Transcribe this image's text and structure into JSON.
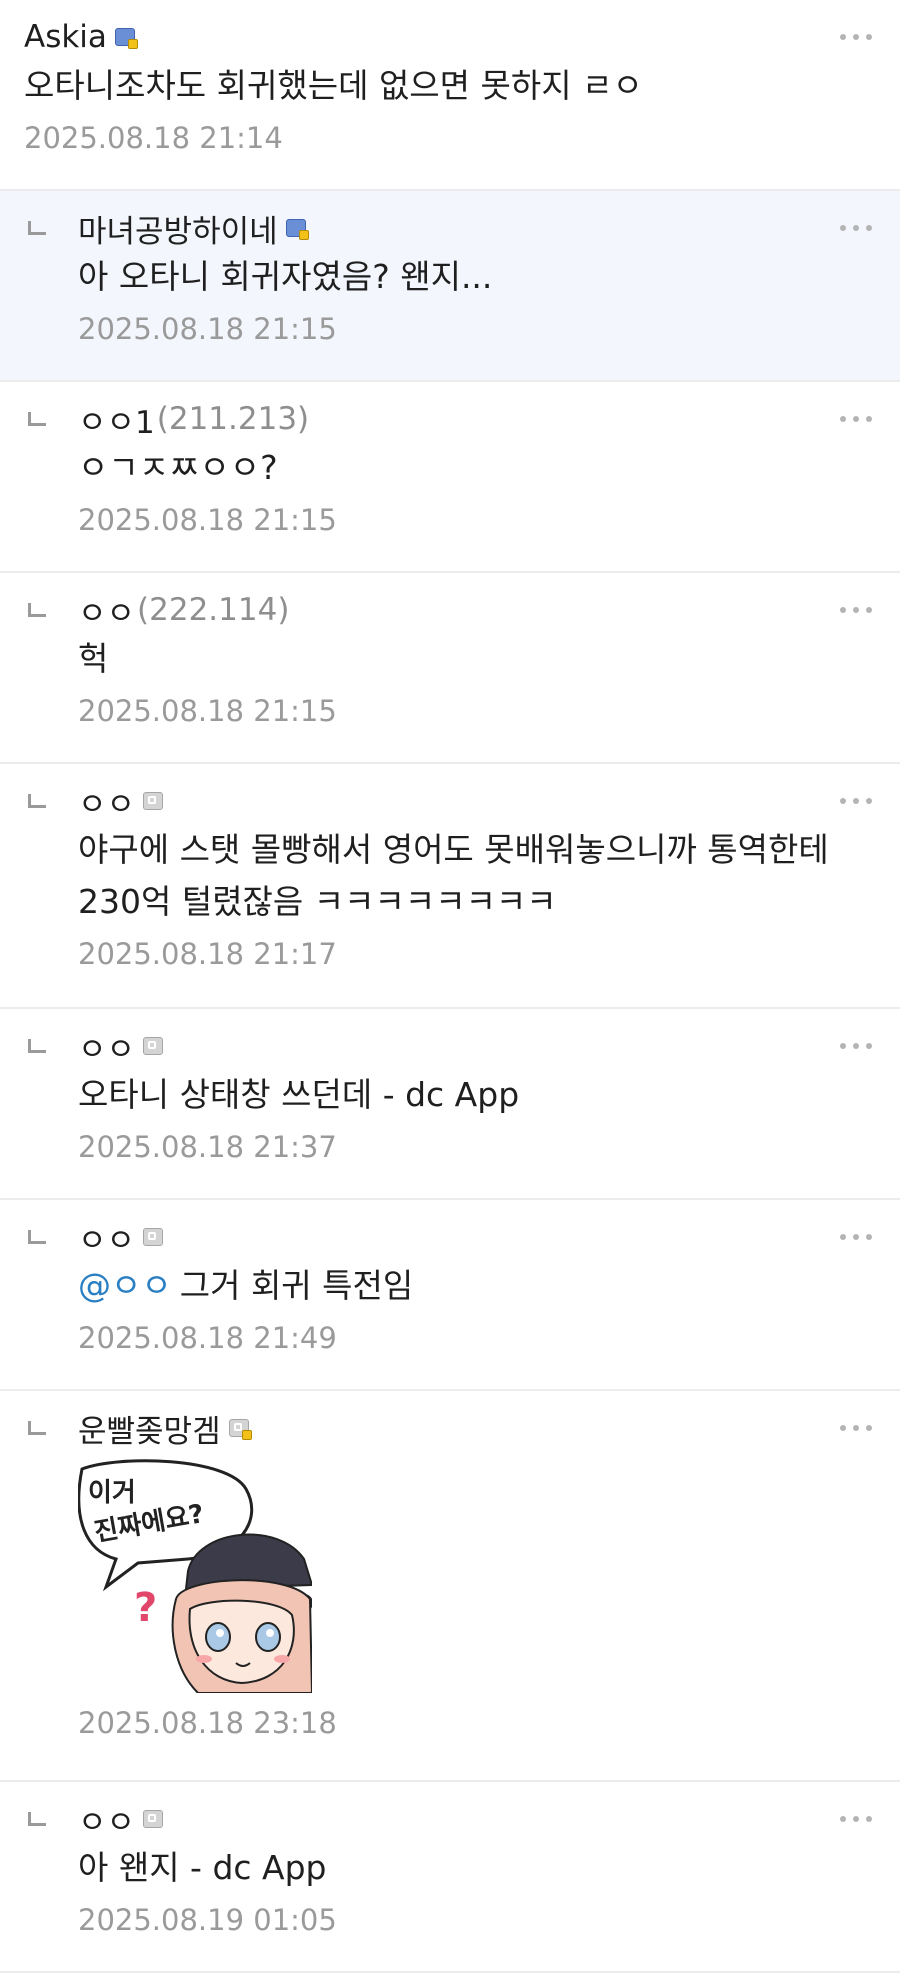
{
  "comments": [
    {
      "nick": "Askia",
      "ip": "",
      "text": "오타니조차도 회귀했는데 없으면 못하지 ㄹㅇ",
      "time": "2025.08.18 21:14"
    },
    {
      "nick": "마녀공방하이네",
      "ip": "",
      "text": "아 오타니 회귀자였음? 왠지...",
      "time": "2025.08.18 21:15"
    },
    {
      "nick": "ㅇㅇ1",
      "ip": "(211.213)",
      "text": "ㅇㄱㅈㅉㅇㅇ?",
      "time": "2025.08.18 21:15"
    },
    {
      "nick": "ㅇㅇ",
      "ip": "(222.114)",
      "text": "헉",
      "time": "2025.08.18 21:15"
    },
    {
      "nick": "ㅇㅇ",
      "ip": "",
      "text": "야구에 스탯 몰빵해서 영어도 못배워놓으니까 통역한테 230억 털렸잖음 ㅋㅋㅋㅋㅋㅋㅋㅋ",
      "time": "2025.08.18 21:17"
    },
    {
      "nick": "ㅇㅇ",
      "ip": "",
      "text": "오타니 상태창 쓰던데 - dc App",
      "time": "2025.08.18 21:37"
    },
    {
      "nick": "ㅇㅇ",
      "ip": "",
      "mention": "@ㅇㅇ",
      "text": "그거 회귀 특전임",
      "time": "2025.08.18 21:49"
    },
    {
      "nick": "운빨좆망겜",
      "ip": "",
      "sticker_text": [
        "이거",
        "진짜에요?"
      ],
      "sticker_mark": "?",
      "time": "2025.08.18 23:18"
    },
    {
      "nick": "ㅇㅇ",
      "ip": "",
      "text": "아 왠지 - dc App",
      "time": "2025.08.19 01:05"
    }
  ]
}
